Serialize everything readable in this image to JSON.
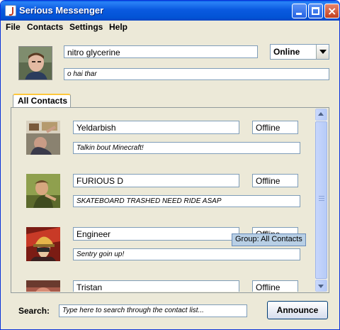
{
  "window": {
    "title": "Serious Messenger",
    "icon": "java-cup-icon"
  },
  "menu": [
    "File",
    "Contacts",
    "Settings",
    "Help"
  ],
  "profile": {
    "display_name": "nitro glycerine",
    "status_message": "o hai thar",
    "presence": "Online"
  },
  "tabs": [
    {
      "label": "All Contacts",
      "selected": true
    }
  ],
  "contacts": [
    {
      "name": "Yeldarbish",
      "status": "Offline",
      "message": "Talkin bout Minecraft!"
    },
    {
      "name": "FURIOUS D",
      "status": "Offline",
      "message": "SKATEBOARD TRASHED NEED RIDE ASAP"
    },
    {
      "name": "Engineer",
      "status": "Offline",
      "message": "Sentry goin up!"
    },
    {
      "name": "Tristan",
      "status": "Offline",
      "message": ""
    }
  ],
  "tooltip": "Group: All Contacts",
  "search": {
    "label": "Search:",
    "placeholder": "Type here to search through the contact list..."
  },
  "announce_label": "Announce",
  "colors": {
    "titlebar": "#0a5ae0",
    "window_bg": "#ece9d8",
    "field_border": "#7f9db9",
    "tab_highlight": "#ffc83c"
  }
}
